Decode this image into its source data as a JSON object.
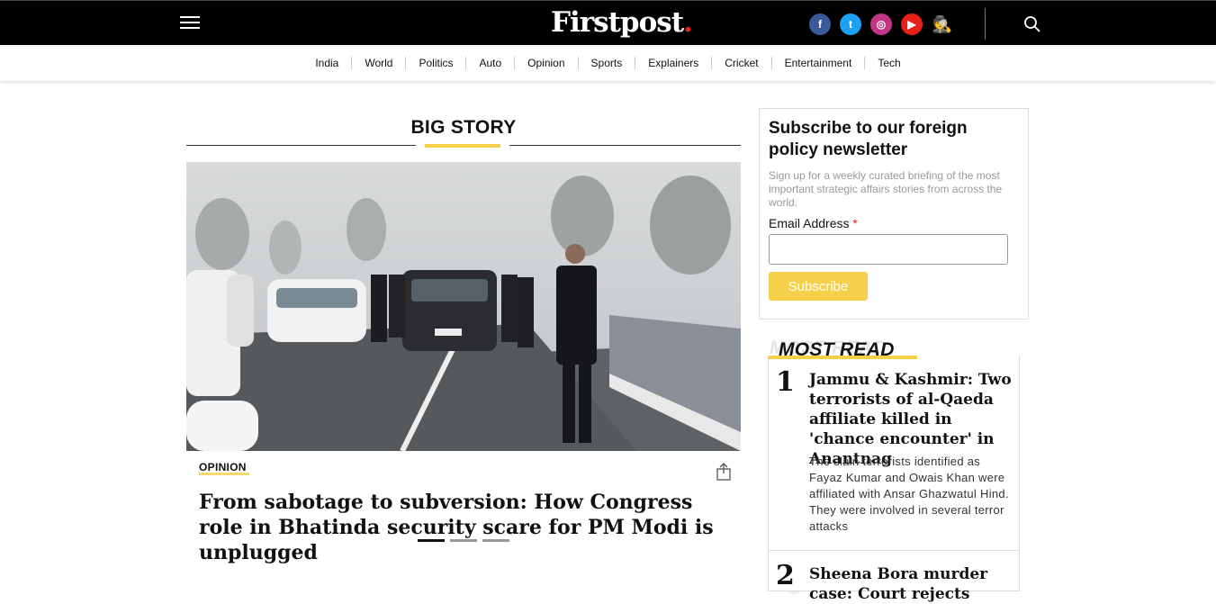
{
  "header": {
    "logo_text": "Firstpost",
    "logo_dot": ".",
    "socials": [
      {
        "name": "facebook",
        "glyph": "f"
      },
      {
        "name": "twitter",
        "glyph": "t"
      },
      {
        "name": "instagram",
        "glyph": "◎"
      },
      {
        "name": "youtube",
        "glyph": "▶"
      },
      {
        "name": "profile",
        "glyph": "🕵"
      }
    ]
  },
  "nav": {
    "items": [
      "India",
      "World",
      "Politics",
      "Auto",
      "Opinion",
      "Sports",
      "Explainers",
      "Cricket",
      "Entertainment",
      "Tech"
    ]
  },
  "big_story": {
    "section_title": "BIG STORY",
    "tag": "OPINION",
    "headline": "From sabotage to subversion: How Congress role in Bhatinda security scare for PM Modi is unplugged",
    "slides": 3,
    "active_slide": 0
  },
  "newsletter": {
    "title": "Subscribe to our foreign policy newsletter",
    "description": "Sign up for a weekly curated briefing of the most important strategic affairs stories from across the world.",
    "email_label": "Email Address",
    "required_mark": "*",
    "email_value": "",
    "button_label": "Subscribe"
  },
  "most_read": {
    "title": "MOST READ",
    "items": [
      {
        "rank": "1",
        "title": "Jammu & Kashmir: Two terrorists of al-Qaeda affiliate killed in 'chance encounter' in Anantnag",
        "description": "The slain terrorists identified as Fayaz Kumar and Owais Khan were affiliated with Ansar Ghazwatul Hind. They were involved in several terror attacks"
      },
      {
        "rank": "2",
        "title": "Sheena Bora murder case: Court rejects",
        "description": ""
      }
    ]
  },
  "colors": {
    "accent": "#f5d04a",
    "logo_dot": "#e1261c",
    "topbar": "#000000"
  }
}
